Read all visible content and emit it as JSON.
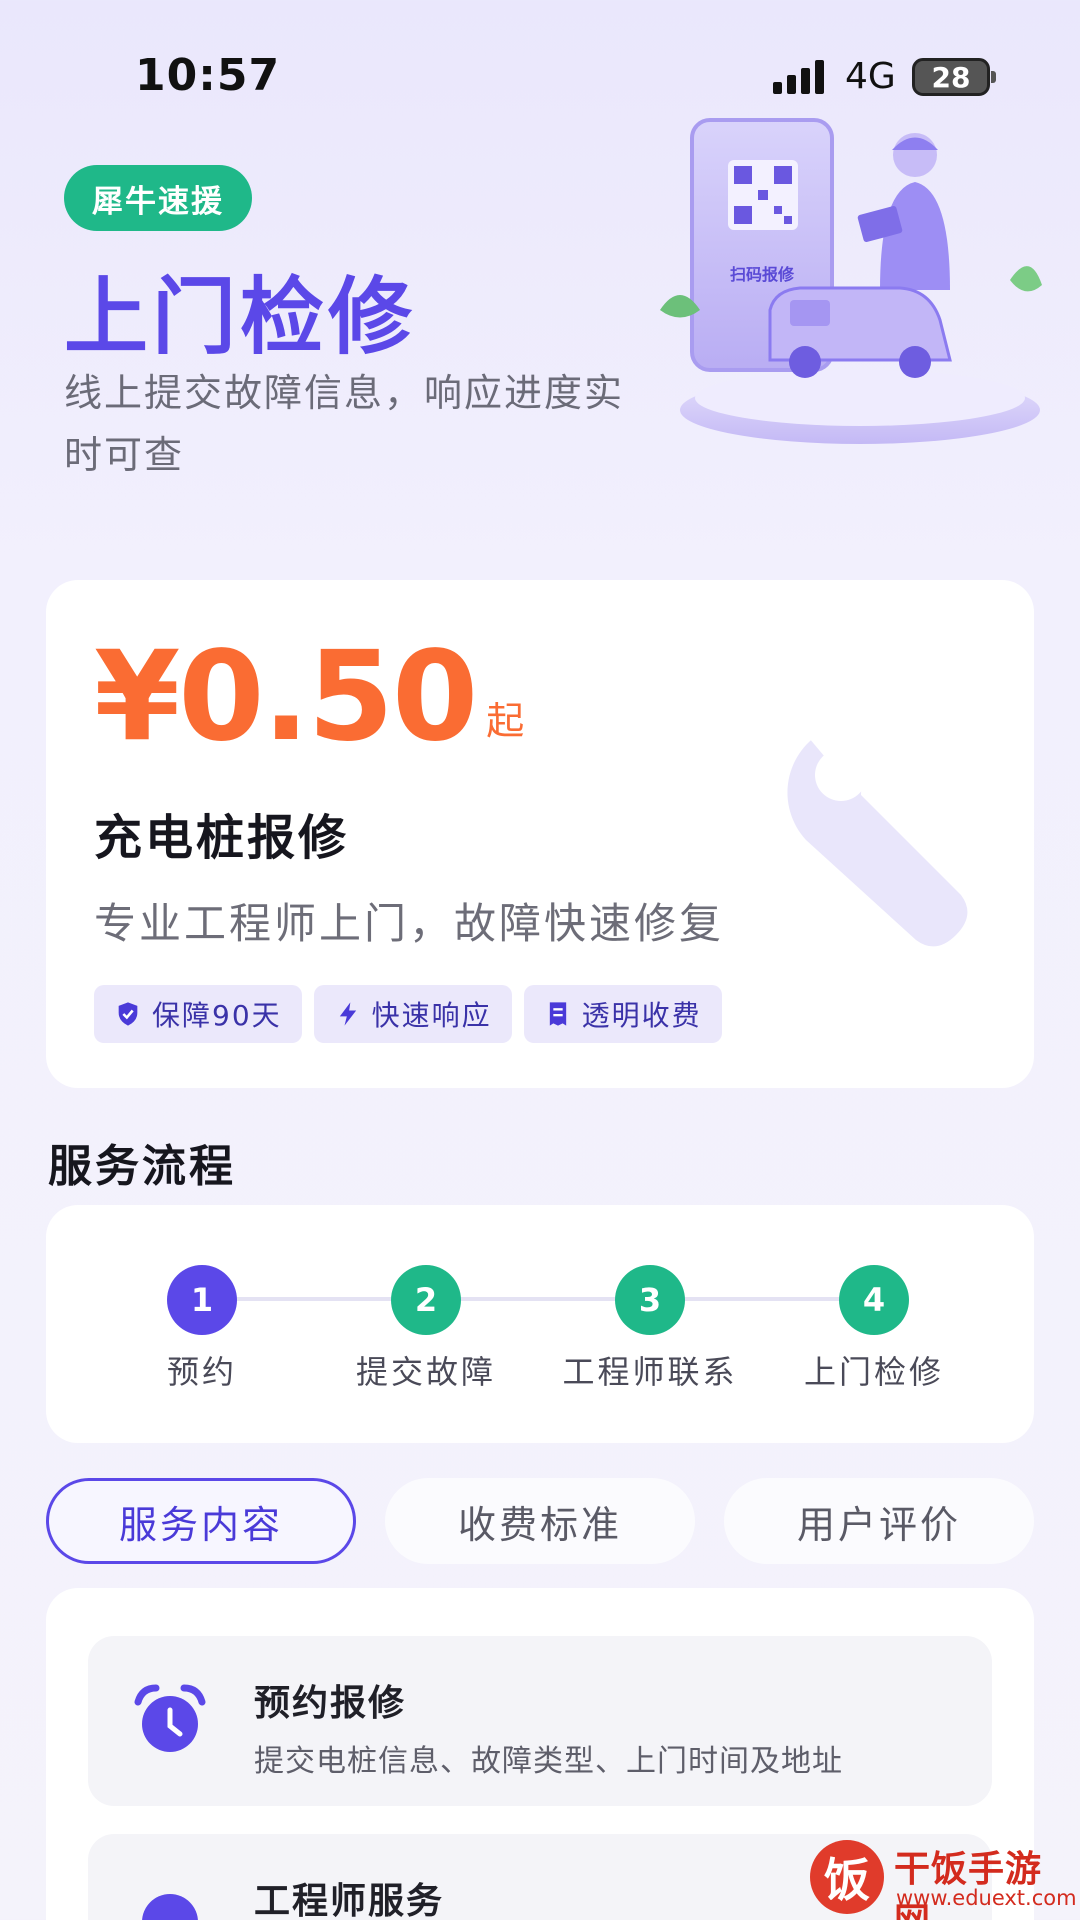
{
  "status_bar": {
    "time": "10:57",
    "network": "4G",
    "battery": "28"
  },
  "hero": {
    "brand_badge": "犀牛速援",
    "title": "上门检修",
    "subtitle": "线上提交故障信息，响应进度实时可查",
    "illustration_label": "扫码报修"
  },
  "price_card": {
    "price": "¥0.50",
    "price_suffix": "起",
    "service_name": "充电桩报修",
    "description": "专业工程师上门，故障快速修复",
    "tags": [
      {
        "icon": "shield-check-icon",
        "label": "保障90天"
      },
      {
        "icon": "lightning-icon",
        "label": "快速响应"
      },
      {
        "icon": "receipt-icon",
        "label": "透明收费"
      }
    ]
  },
  "process": {
    "title": "服务流程",
    "steps": [
      {
        "number": "1",
        "label": "预约",
        "state": "active"
      },
      {
        "number": "2",
        "label": "提交故障",
        "state": "done"
      },
      {
        "number": "3",
        "label": "工程师联系",
        "state": "done"
      },
      {
        "number": "4",
        "label": "上门检修",
        "state": "done"
      }
    ]
  },
  "tabs": [
    {
      "label": "服务内容",
      "active": true
    },
    {
      "label": "收费标准",
      "active": false
    },
    {
      "label": "用户评价",
      "active": false
    }
  ],
  "content_items": [
    {
      "icon": "alarm-clock-icon",
      "title": "预约报修",
      "description": "提交电桩信息、故障类型、上门时间及地址"
    },
    {
      "icon": "engineer-icon",
      "title": "工程师服务",
      "description": ""
    }
  ],
  "watermark": {
    "logo_char": "饭",
    "name": "干饭手游网",
    "url": "www.eduext.com"
  },
  "colors": {
    "accent": "#5b48e8",
    "green": "#1fb889",
    "price": "#fa6c33"
  }
}
